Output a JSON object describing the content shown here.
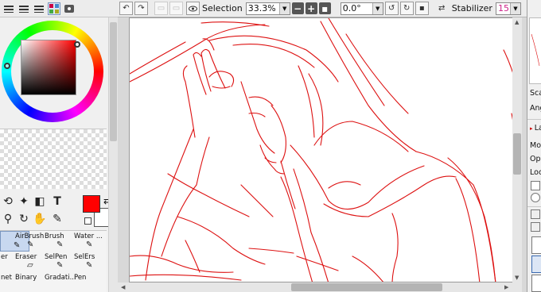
{
  "toolbar": {
    "selection_label": "Selection",
    "zoom_value": "33.3%",
    "rotation_value": "0.0°",
    "stabilizer_label": "Stabilizer",
    "stabilizer_value": "15"
  },
  "brushes": [
    {
      "label": "",
      "selected": true
    },
    {
      "label": "AirBrush"
    },
    {
      "label": "Brush"
    },
    {
      "label": "Water ..."
    },
    {
      "label": "er"
    },
    {
      "label": "Eraser"
    },
    {
      "label": "SelPen"
    },
    {
      "label": "SelErs"
    },
    {
      "label": "net"
    },
    {
      "label": "Binary"
    },
    {
      "label": "Gradati..."
    },
    {
      "label": "Pen"
    }
  ],
  "colors": {
    "primary": "#ff0000",
    "secondary": "#ffffff",
    "line_art": "#dd1111"
  },
  "right_panel": {
    "scale_label": "Sca",
    "angle_label": "Ang",
    "layer_header": "La",
    "mode_label": "Mo",
    "opacity_label": "Opa",
    "lock_label": "Loc"
  }
}
